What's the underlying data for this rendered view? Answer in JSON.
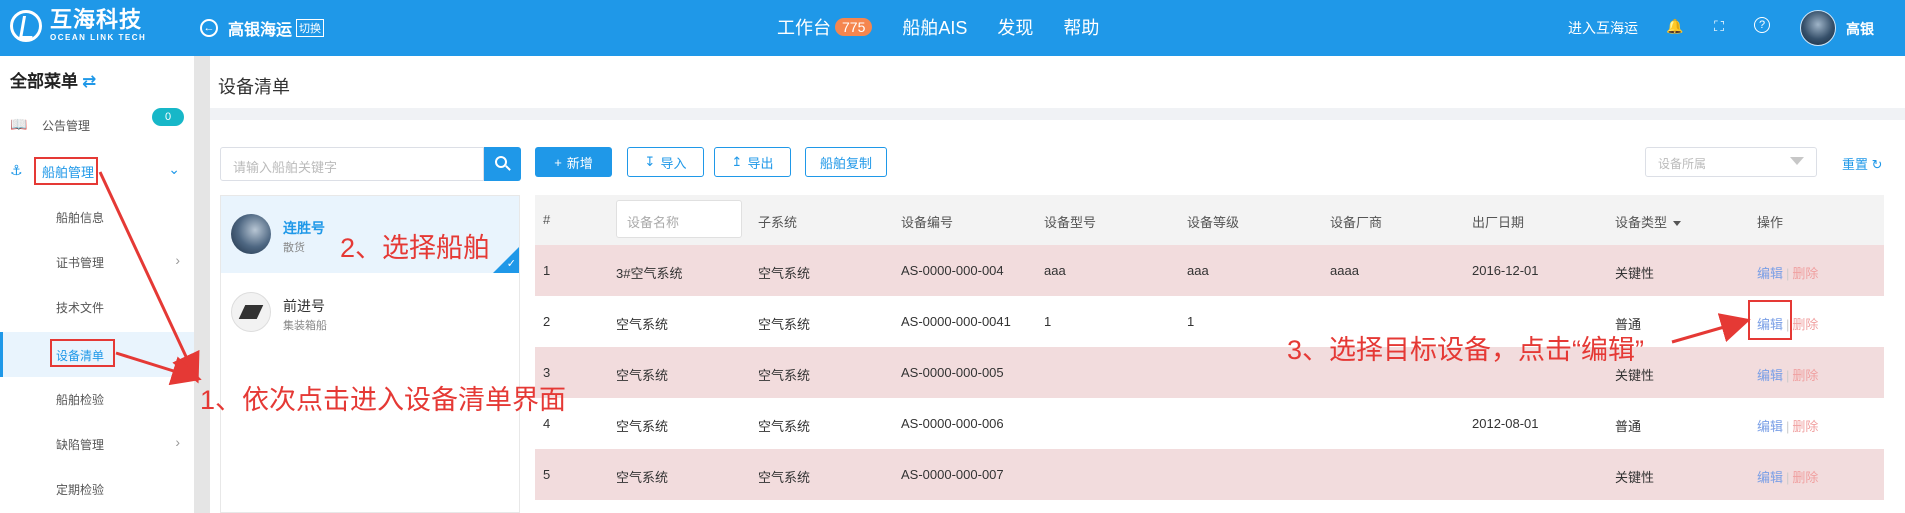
{
  "header": {
    "logo_cn": "互海科技",
    "logo_en": "OCEAN LINK TECH",
    "company": "高银海运",
    "switch_label": "切换",
    "nav": [
      {
        "label": "工作台",
        "badge": "775"
      },
      {
        "label": "船舶AIS"
      },
      {
        "label": "发现"
      },
      {
        "label": "帮助"
      }
    ],
    "enter_link": "进入互海运",
    "user_name": "高银"
  },
  "sidebar": {
    "title": "全部菜单",
    "announcement": {
      "label": "公告管理",
      "badge": "0"
    },
    "group": {
      "label": "船舶管理"
    },
    "items": [
      {
        "label": "船舶信息"
      },
      {
        "label": "证书管理"
      },
      {
        "label": "技术文件"
      },
      {
        "label": "设备清单"
      },
      {
        "label": "船舶检验"
      },
      {
        "label": "缺陷管理"
      },
      {
        "label": "定期检验"
      }
    ]
  },
  "page": {
    "title": "设备清单",
    "search_placeholder": "请输入船舶关键字",
    "filter_placeholder": "设备所属",
    "reset_label": "重置"
  },
  "toolbar": {
    "add_label": "新增",
    "import_label": "导入",
    "export_label": "导出",
    "copy_label": "船舶复制"
  },
  "ships": [
    {
      "name": "连胜号",
      "type": "散货"
    },
    {
      "name": "前进号",
      "type": "集装箱船"
    }
  ],
  "table": {
    "columns": [
      "#",
      "设备名称",
      "子系统",
      "设备编号",
      "设备型号",
      "设备等级",
      "设备厂商",
      "出厂日期",
      "设备类型",
      "操作"
    ],
    "edit_label": "编辑",
    "delete_label": "删除",
    "rows": [
      {
        "no": "1",
        "name": "3#空气系统",
        "subsystem": "空气系统",
        "code": "AS-0000-000-004",
        "model": "aaa",
        "grade": "aaa",
        "maker": "aaaa",
        "date": "2016-12-01",
        "type": "关键性"
      },
      {
        "no": "2",
        "name": "空气系统",
        "subsystem": "空气系统",
        "code": "AS-0000-000-0041",
        "model": "1",
        "grade": "1",
        "maker": "",
        "date": "",
        "type": "普通"
      },
      {
        "no": "3",
        "name": "空气系统",
        "subsystem": "空气系统",
        "code": "AS-0000-000-005",
        "model": "",
        "grade": "",
        "maker": "",
        "date": "",
        "type": "关键性"
      },
      {
        "no": "4",
        "name": "空气系统",
        "subsystem": "空气系统",
        "code": "AS-0000-000-006",
        "model": "",
        "grade": "",
        "maker": "",
        "date": "2012-08-01",
        "type": "普通"
      },
      {
        "no": "5",
        "name": "空气系统",
        "subsystem": "空气系统",
        "code": "AS-0000-000-007",
        "model": "",
        "grade": "",
        "maker": "",
        "date": "",
        "type": "关键性"
      }
    ]
  },
  "annotations": {
    "step1": "1、依次点击进入设备清单界面",
    "step2": "2、选择船舶",
    "step3": "3、选择目标设备，点击“编辑”",
    "color": "#e53935"
  }
}
